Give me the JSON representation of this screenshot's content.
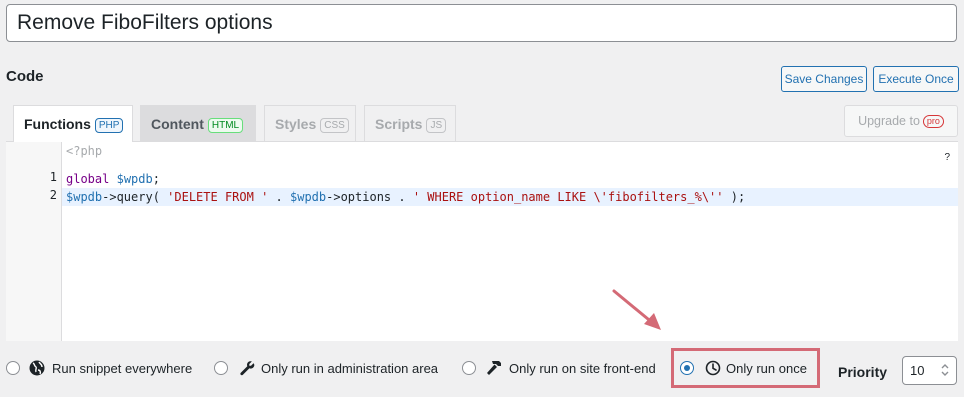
{
  "snippet": {
    "title": "Remove FiboFilters options"
  },
  "code_section": {
    "heading": "Code",
    "save_label": "Save Changes",
    "execute_label": "Execute Once",
    "upgrade_label": "Upgrade to",
    "upgrade_badge": "pro"
  },
  "tabs": [
    {
      "label": "Functions",
      "badge": "PHP",
      "state": "active"
    },
    {
      "label": "Content",
      "badge": "HTML",
      "state": "enabled"
    },
    {
      "label": "Styles",
      "badge": "CSS",
      "state": "disabled"
    },
    {
      "label": "Scripts",
      "badge": "JS",
      "state": "disabled"
    }
  ],
  "editor": {
    "php_open_tag": "<?php",
    "help_icon_text": "?",
    "lines": [
      {
        "number": "1"
      },
      {
        "number": "2"
      }
    ],
    "tokens": {
      "l1_kw": "global",
      "l1_var": "$wpdb",
      "l1_end": ";",
      "l2_var1": "$wpdb",
      "l2_call": "->query( ",
      "l2_str1": "'DELETE FROM '",
      "l2_dot1": " . ",
      "l2_var2": "$wpdb",
      "l2_prop": "->options . ",
      "l2_str2": "' WHERE option_name LIKE \\'fibofilters_%\\''",
      "l2_end": " );"
    }
  },
  "scope": {
    "options": [
      {
        "label": "Run snippet everywhere",
        "icon": "globe-icon",
        "checked": false
      },
      {
        "label": "Only run in administration area",
        "icon": "wrench-icon",
        "checked": false
      },
      {
        "label": "Only run on site front-end",
        "icon": "hammer-icon",
        "checked": false
      },
      {
        "label": "Only run once",
        "icon": "clock-icon",
        "checked": true
      }
    ],
    "highlight_color": "#d46a76"
  },
  "priority": {
    "label": "Priority",
    "value": "10"
  },
  "colors": {
    "accent": "#2271b1",
    "annotation": "#d46a76"
  }
}
